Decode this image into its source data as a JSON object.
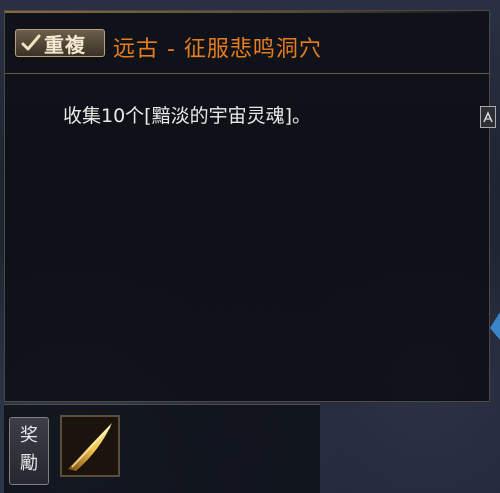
{
  "quest": {
    "repeat_label": "重複",
    "title": "远古 - 征服悲鸣洞穴",
    "objective": "收集10个[黯淡的宇宙灵魂]。"
  },
  "reward": {
    "label_line1": "奖",
    "label_line2": "勵",
    "item_icon": "golden-blade-icon"
  },
  "colors": {
    "title": "#e67d1f",
    "text": "#e9e9e6",
    "badge_border": "#b9a27a"
  }
}
